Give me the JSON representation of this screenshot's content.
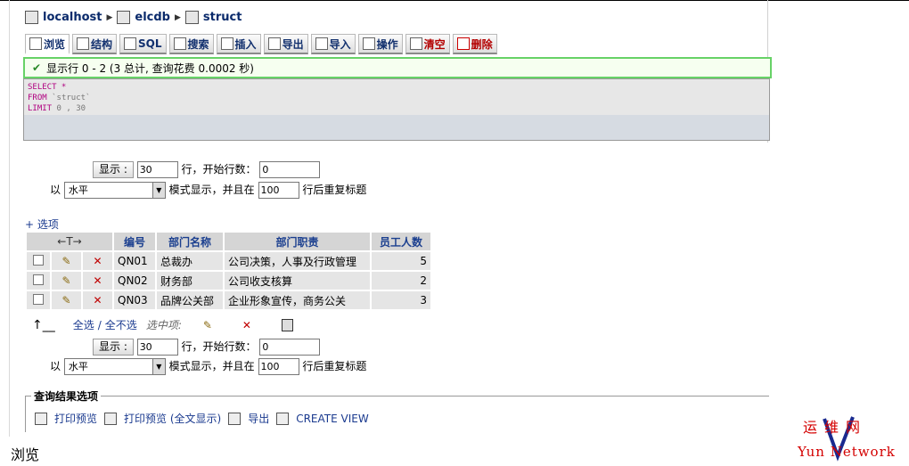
{
  "breadcrumb": {
    "server": "localhost",
    "database": "elcdb",
    "table": "struct"
  },
  "tabs": [
    {
      "label": "浏览",
      "icon": "browse-icon",
      "active": true
    },
    {
      "label": "结构",
      "icon": "structure-icon"
    },
    {
      "label": "SQL",
      "icon": "sql-icon"
    },
    {
      "label": "搜索",
      "icon": "search-icon"
    },
    {
      "label": "插入",
      "icon": "insert-icon"
    },
    {
      "label": "导出",
      "icon": "export-icon"
    },
    {
      "label": "导入",
      "icon": "import-icon"
    },
    {
      "label": "操作",
      "icon": "operations-icon"
    },
    {
      "label": "清空",
      "icon": "empty-icon",
      "red": true
    },
    {
      "label": "删除",
      "icon": "drop-icon",
      "red": true
    }
  ],
  "notice": "显示行 0 - 2 (3 总计, 查询花费 0.0002 秒)",
  "sql": {
    "select": "SELECT *",
    "from_kw": "FROM",
    "from_tbl": "`struct`",
    "limit_kw": "LIMIT",
    "limit_val": "0 , 30"
  },
  "nav": {
    "show_button": "显示 :",
    "rows_value": "30",
    "rows_label": "行，开始行数：",
    "start_value": "0",
    "mode_prefix": "以",
    "mode_value": "水平",
    "mode_label": "模式显示，并且在",
    "repeat_value": "100",
    "repeat_label": "行后重复标题"
  },
  "options_link": "+ 选项",
  "table": {
    "arrows_header": "←T→",
    "columns": [
      "编号",
      "部门名称",
      "部门职责",
      "员工人数"
    ],
    "rows": [
      {
        "id": "QN01",
        "name": "总裁办",
        "duty": "公司决策，人事及行政管理",
        "count": "5"
      },
      {
        "id": "QN02",
        "name": "财务部",
        "duty": "公司收支核算",
        "count": "2"
      },
      {
        "id": "QN03",
        "name": "品牌公关部",
        "duty": "企业形象宣传，商务公关",
        "count": "3"
      }
    ]
  },
  "bulk": {
    "select_all": "全选",
    "sep": "/",
    "deselect_all": "全不选",
    "with_selected": "选中项:"
  },
  "results": {
    "legend": "查询结果选项",
    "print_view": "打印预览",
    "print_view_full": "打印预览 (全文显示)",
    "export": "导出",
    "create_view": "CREATE VIEW"
  },
  "caption": "浏览",
  "logo": {
    "top": "运维网",
    "bottom": "Yun Network"
  }
}
